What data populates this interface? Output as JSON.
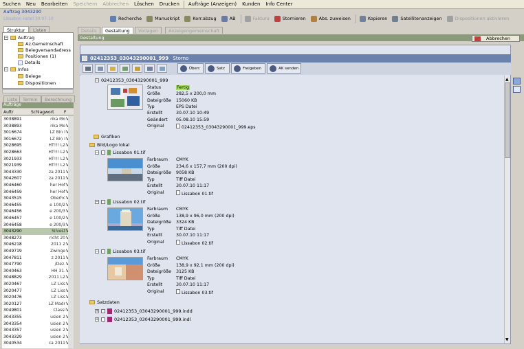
{
  "menu": [
    "Suchen",
    "Neu",
    "Bearbeiten",
    "Speichern",
    "Abbrechen",
    "Löschen",
    "Drucken",
    "Aufträge (Anzeigen)",
    "Kunden",
    "Info Center"
  ],
  "menu_disabled": [
    false,
    false,
    false,
    true,
    true,
    false,
    false,
    false,
    false,
    false
  ],
  "window_title": "Auftrag 3043290",
  "window_subtitle": "Lissabon Hotel 30.07.10",
  "toolbar": [
    "Recherche",
    "Manuskript",
    "Korr.abzug",
    "AB",
    "Faktura",
    "Stornieren",
    "Abs. zuweisen",
    "Kopieren",
    "Satellitenanzeigen",
    "Dispositionen aktivieren"
  ],
  "toolbar_disabled": [
    false,
    false,
    false,
    false,
    true,
    false,
    false,
    false,
    false,
    true
  ],
  "tabs_left": [
    "Struktur",
    "Listen"
  ],
  "tabs_main": [
    "Details",
    "Gestaltung",
    "Vorlagen",
    "Anzeigengemeinschaft"
  ],
  "structure": {
    "root": "Auftrag",
    "children": [
      "Az.Gemeinschaft",
      "Belegversandadress",
      "Positionen (1)",
      "Details"
    ],
    "root2": "Infos",
    "children2": [
      "Belege",
      "Dispositionen"
    ]
  },
  "list_tabs": [
    "Liste",
    "Termin",
    "Berechnung"
  ],
  "list_section": "Aufträge",
  "list_headers": [
    "Auftr",
    "Schlagwort",
    "F"
  ],
  "list_rows": [
    [
      "3038891",
      "rika Mo",
      "V"
    ],
    [
      "3038893",
      "rika Mo",
      "V"
    ],
    [
      "3016674",
      "LZ Bin I",
      "V"
    ],
    [
      "3016672",
      "LZ Bin I",
      "V"
    ],
    [
      "3028695",
      "HT!!! L2",
      "V"
    ],
    [
      "3028663",
      "HT!!! L2",
      "V"
    ],
    [
      "3021933",
      "HT!!! L2",
      "V"
    ],
    [
      "3021939",
      "HT!!! L2",
      "V"
    ],
    [
      "3043330",
      "za 2011",
      "V"
    ],
    [
      "3042607",
      "za 2011",
      "V"
    ],
    [
      "3046460",
      "her Hof",
      "V"
    ],
    [
      "3046459",
      "her Hof",
      "V"
    ],
    [
      "3043515",
      "Oberhc",
      "V"
    ],
    [
      "3046455",
      "e 100/2",
      "V"
    ],
    [
      "3046456",
      "e 200/3",
      "V"
    ],
    [
      "3046457",
      "e 100/2",
      "V"
    ],
    [
      "3046458",
      "e 200/3",
      "V"
    ],
    [
      "3043290",
      "Silvest",
      "V"
    ],
    [
      "3048273",
      "richt 20",
      "V"
    ],
    [
      "3046218",
      "2011 2",
      "V"
    ],
    [
      "3049719",
      "Zwinge",
      "V"
    ],
    [
      "3047811",
      "z 2011",
      "V"
    ],
    [
      "3047790",
      "/Dez.",
      "V"
    ],
    [
      "3040463",
      "HH 31.",
      "V"
    ],
    [
      "3048829",
      "2011 L2",
      "V"
    ],
    [
      "3020467",
      "LZ Liss",
      "V"
    ],
    [
      "3020477",
      "LZ Liss",
      "V"
    ],
    [
      "3020476",
      "LZ Liss",
      "V"
    ],
    [
      "3020127",
      "LZ Madr",
      "V"
    ],
    [
      "3049801",
      "Classi",
      "V"
    ],
    [
      "3043355",
      "usien 2",
      "V"
    ],
    [
      "3043354",
      "usien 2",
      "V"
    ],
    [
      "3043357",
      "usien 2",
      "V"
    ],
    [
      "3043329",
      "usien 2",
      "V"
    ],
    [
      "3040534",
      "ca 2011",
      "V"
    ]
  ],
  "selected_row": 17,
  "gestaltung_label": "Gestaltung",
  "abbrechen_label": "Abbrechen",
  "main_header": "02412353_03043290001_999",
  "main_header_status": "Storno",
  "main_buttons": [
    "Überr.",
    "Satz",
    "Freigeben",
    "AK senden"
  ],
  "doc": {
    "name": "02412353_03043290001_999",
    "props": [
      [
        "Status",
        "Fertig"
      ],
      [
        "Größe",
        "282,5 x 200,0 mm"
      ],
      [
        "Dateigröße",
        "15060 KB"
      ],
      [
        "Typ",
        "EPS Datei"
      ],
      [
        "Erstellt",
        "30.07.10 10:49"
      ],
      [
        "Geändert",
        "05.08.10 15:59"
      ],
      [
        "Original",
        "02412353_03043290001_999.eps"
      ]
    ]
  },
  "folder_grafiken": "Grafiken",
  "folder_bild": "Bild/Logo lokal",
  "images": [
    {
      "name": "Lissabon 01.tif",
      "props": [
        [
          "Farbraum",
          "CMYK"
        ],
        [
          "Größe",
          "234,6 x 157,7 mm (200 dpi)"
        ],
        [
          "Dateigröße",
          "9058 KB"
        ],
        [
          "Typ",
          "Tiff Datei"
        ],
        [
          "Erstellt",
          "30.07.10 11:17"
        ],
        [
          "Original",
          "Lissabon 01.tif"
        ]
      ]
    },
    {
      "name": "Lissabon 02.tif",
      "props": [
        [
          "Farbraum",
          "CMYK"
        ],
        [
          "Größe",
          "138,9 x 96,0 mm (200 dpi)"
        ],
        [
          "Dateigröße",
          "3324 KB"
        ],
        [
          "Typ",
          "Tiff Datei"
        ],
        [
          "Erstellt",
          "30.07.10 11:17"
        ],
        [
          "Original",
          "Lissabon 02.tif"
        ]
      ]
    },
    {
      "name": "Lissabon 03.tif",
      "props": [
        [
          "Farbraum",
          "CMYK"
        ],
        [
          "Größe",
          "138,9 x 92,1 mm (200 dpi)"
        ],
        [
          "Dateigröße",
          "3125 KB"
        ],
        [
          "Typ",
          "Tiff Datei"
        ],
        [
          "Erstellt",
          "30.07.10 11:17"
        ],
        [
          "Original",
          "Lissabon 03.tif"
        ]
      ]
    }
  ],
  "folder_satz": "Satzdaten",
  "satz_files": [
    "02412353_03043290001_999.indd",
    "02412353_03043290001_999.indl"
  ]
}
